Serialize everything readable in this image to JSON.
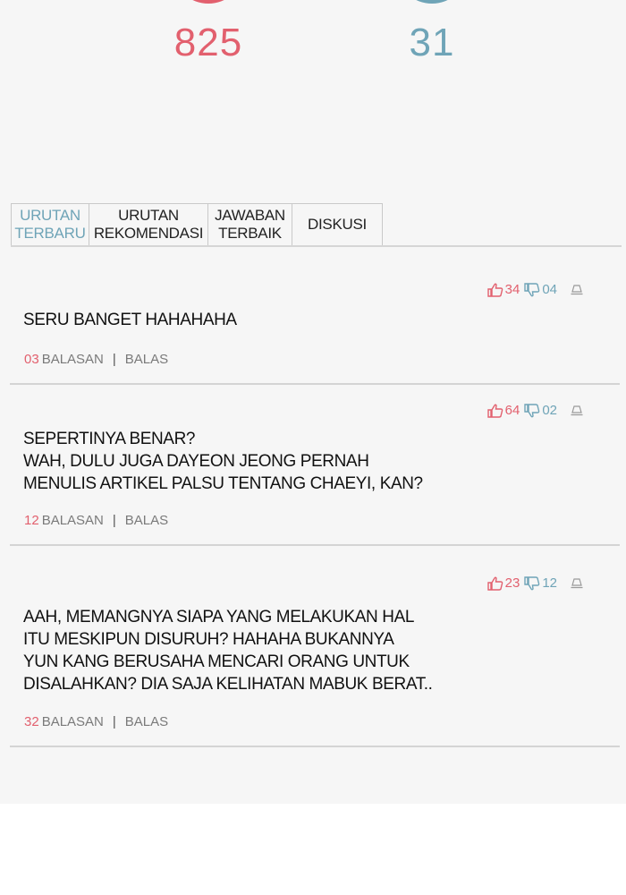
{
  "reactions": {
    "like_count": "825",
    "dislike_count": "31",
    "colors": {
      "like": "#e2606e",
      "dislike": "#6fa4b7"
    }
  },
  "tabs": [
    {
      "label": "URUTAN\nTERBARU",
      "active": true
    },
    {
      "label": "URUTAN\nREKOMENDASI",
      "active": false
    },
    {
      "label": "JAWABAN\nTERBAIK",
      "active": false
    },
    {
      "label": "DISKUSI",
      "active": false
    }
  ],
  "comments": [
    {
      "likes": "34",
      "dislikes": "04",
      "text": "SERU BANGET HAHAHAHA",
      "reply_count": "03",
      "replies_label": "BALASAN",
      "reply_action": "BALAS"
    },
    {
      "likes": "64",
      "dislikes": "02",
      "text": "SEPERTINYA BENAR?\nWAH, DULU JUGA DAYEON JEONG PERNAH\nMENULIS ARTIKEL PALSU TENTANG CHAEYI, KAN?",
      "reply_count": "12",
      "replies_label": "BALASAN",
      "reply_action": "BALAS"
    },
    {
      "likes": "23",
      "dislikes": "12",
      "text": "AAH, MEMANGNYA SIAPA YANG MELAKUKAN HAL\nITU MESKIPUN DISURUH?  HAHAHA BUKANNYA\nYUN KANG BERUSAHA MENCARI ORANG UNTUK\nDISALAHKAN?  DIA SAJA KELIHATAN MABUK BERAT..",
      "reply_count": "32",
      "replies_label": "BALASAN",
      "reply_action": "BALAS"
    }
  ]
}
